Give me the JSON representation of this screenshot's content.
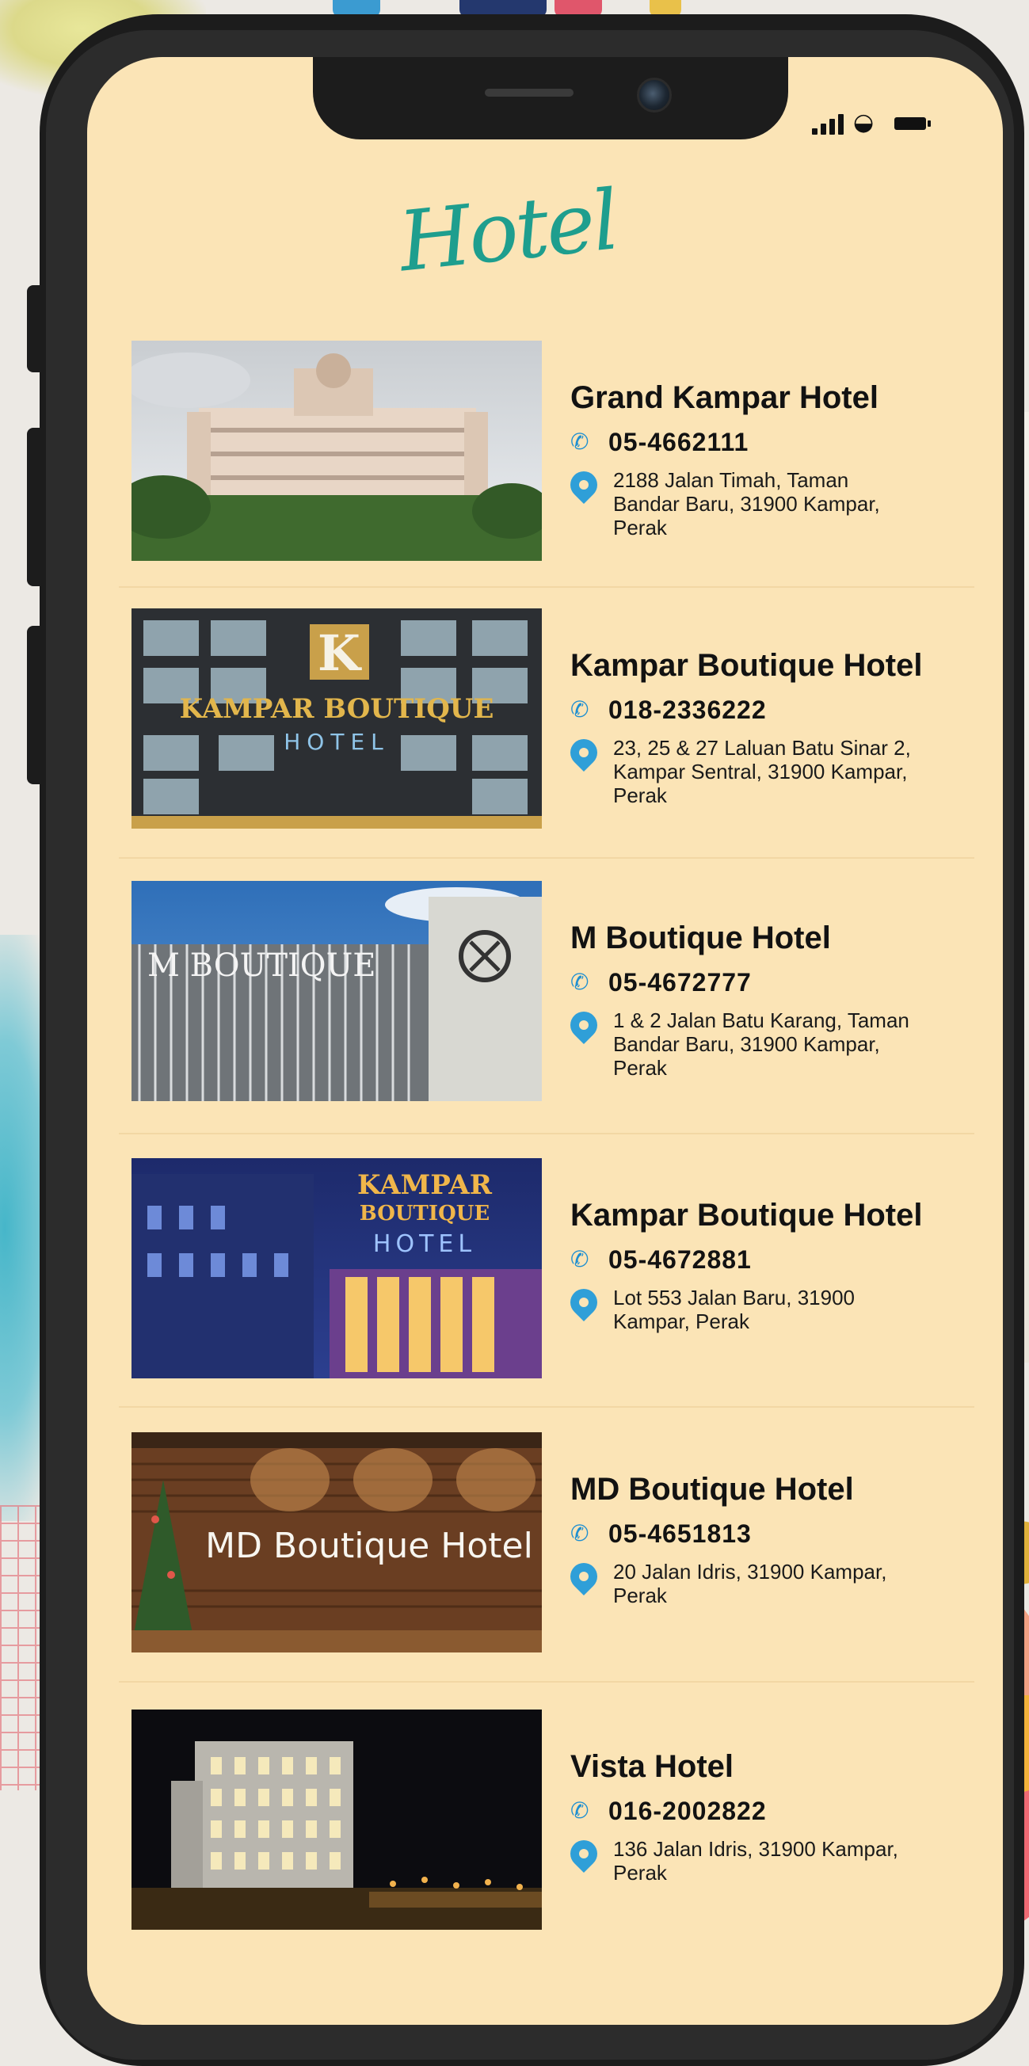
{
  "page": {
    "title": "Hotel"
  },
  "status_bar": {
    "signal_icon": "signal-bars-icon",
    "wifi_icon": "wifi-icon",
    "battery_icon": "battery-icon"
  },
  "colors": {
    "screen_background": "#fbe4b6",
    "title": "#1e9e8e",
    "phone_icon": "#1e8fd1",
    "location_icon": "#2f9fd8"
  },
  "hotels": [
    {
      "name": "Grand Kampar Hotel",
      "phone": "05-4662111",
      "address_lines": [
        "2188 Jalan Timah, Taman",
        "Bandar Baru, 31900 Kampar,",
        "Perak"
      ]
    },
    {
      "name": "Kampar Boutique Hotel",
      "phone": "018-2336222",
      "address_lines": [
        "23, 25 & 27 Laluan Batu Sinar 2,",
        "Kampar Sentral, 31900 Kampar,",
        "Perak"
      ],
      "photo_sign": {
        "letter": "K",
        "line1": "KAMPAR BOUTIQUE",
        "line2": "HOTEL"
      }
    },
    {
      "name": "M Boutique Hotel",
      "phone": "05-4672777",
      "address_lines": [
        "1 & 2 Jalan Batu Karang, Taman",
        "Bandar Baru, 31900 Kampar,",
        "Perak"
      ],
      "photo_sign": {
        "line1": "M BOUTIQUE"
      }
    },
    {
      "name": "Kampar Boutique Hotel",
      "phone": "05-4672881",
      "address_lines": [
        "Lot 553 Jalan Baru, 31900",
        "Kampar, Perak"
      ],
      "photo_sign": {
        "line1": "KAMPAR",
        "line2": "BOUTIQUE",
        "line3": "HOTEL"
      }
    },
    {
      "name": "MD Boutique Hotel",
      "phone": "05-4651813",
      "address_lines": [
        "20 Jalan Idris, 31900 Kampar,",
        "Perak"
      ],
      "photo_sign": {
        "line1": "MD Boutique Hotel"
      }
    },
    {
      "name": "Vista Hotel",
      "phone": "016-2002822",
      "address_lines": [
        "136 Jalan Idris, 31900 Kampar,",
        "Perak"
      ]
    }
  ]
}
